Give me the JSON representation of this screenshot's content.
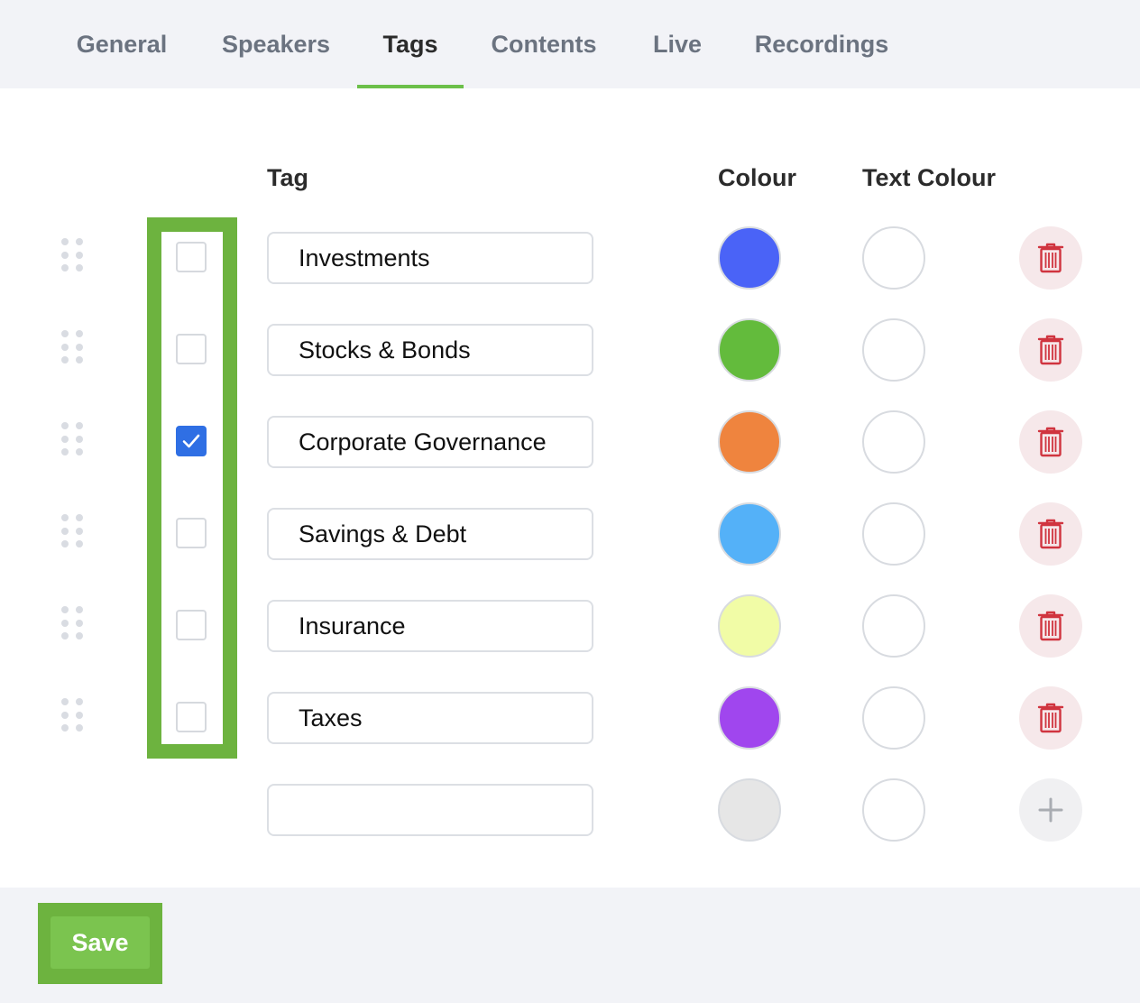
{
  "tabs": [
    {
      "label": "General"
    },
    {
      "label": "Speakers"
    },
    {
      "label": "Tags"
    },
    {
      "label": "Contents"
    },
    {
      "label": "Live"
    },
    {
      "label": "Recordings"
    }
  ],
  "active_tab": "Tags",
  "headers": {
    "tag": "Tag",
    "colour": "Colour",
    "text_colour": "Text Colour"
  },
  "rows": [
    {
      "name": "Investments",
      "checked": false,
      "colour": "#4a63f7",
      "text_colour": "#ffffff"
    },
    {
      "name": "Stocks & Bonds",
      "checked": false,
      "colour": "#63bb3c",
      "text_colour": "#ffffff"
    },
    {
      "name": "Corporate Governance",
      "checked": true,
      "colour": "#ef843e",
      "text_colour": "#ffffff"
    },
    {
      "name": "Savings & Debt",
      "checked": false,
      "colour": "#54b1f8",
      "text_colour": "#ffffff"
    },
    {
      "name": "Insurance",
      "checked": false,
      "colour": "#f1fca6",
      "text_colour": "#ffffff"
    },
    {
      "name": "Taxes",
      "checked": false,
      "colour": "#a046ee",
      "text_colour": "#ffffff"
    }
  ],
  "new_row": {
    "value": "",
    "colour": "#e6e6e6",
    "text_colour": "#ffffff"
  },
  "footer": {
    "save_label": "Save"
  },
  "colors": {
    "accent": "#6cc04a",
    "checkbox_checked": "#2f6fe4",
    "delete_icon": "#d0343f",
    "delete_bg": "#f6e8ea",
    "highlight": "#6db33f"
  },
  "icons": {
    "drag": "drag-handle-icon",
    "delete": "trash-icon",
    "add": "plus-icon",
    "check": "checkmark-icon"
  }
}
